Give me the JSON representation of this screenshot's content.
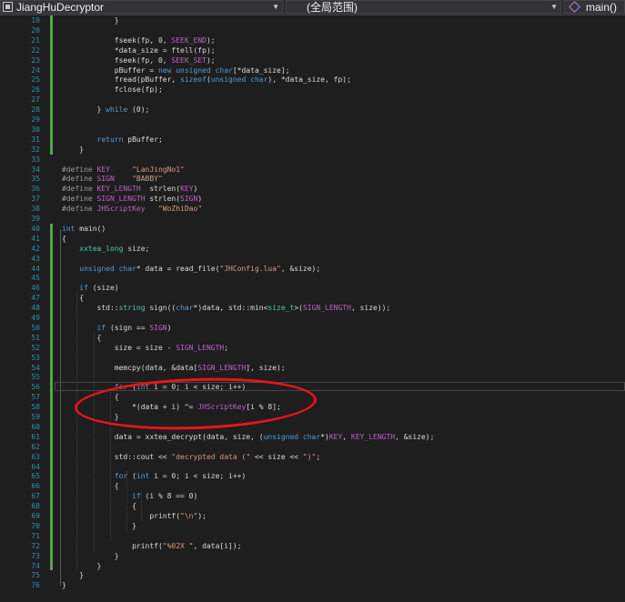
{
  "navbar": {
    "project": "JiangHuDecryptor",
    "scope": "(全局范围)",
    "function": "main()"
  },
  "colors": {
    "background": "#1e1e1e",
    "line_number": "#2b91af",
    "keyword": "#569cd6",
    "string": "#d69d85",
    "macro": "#bd63c5",
    "change_bar": "#57a64a",
    "annotation": "#e8141a"
  },
  "editor": {
    "lines": [
      {
        "n": "19",
        "segs": [
          [
            "            }",
            "p"
          ]
        ]
      },
      {
        "n": "20",
        "segs": []
      },
      {
        "n": "21",
        "segs": [
          [
            "            fseek(fp, 0, ",
            "p"
          ],
          [
            "SEEK_END",
            "mc"
          ],
          [
            ");",
            "p"
          ]
        ]
      },
      {
        "n": "22",
        "segs": [
          [
            "            *data_size = ftell(fp);",
            "p"
          ]
        ]
      },
      {
        "n": "23",
        "segs": [
          [
            "            fseek(fp, 0, ",
            "p"
          ],
          [
            "SEEK_SET",
            "mc"
          ],
          [
            ");",
            "p"
          ]
        ]
      },
      {
        "n": "24",
        "segs": [
          [
            "            pBuffer = ",
            "p"
          ],
          [
            "new unsigned char",
            "kw"
          ],
          [
            "[*data_size];",
            "p"
          ]
        ]
      },
      {
        "n": "25",
        "segs": [
          [
            "            fread(pBuffer, ",
            "p"
          ],
          [
            "sizeof",
            "kw"
          ],
          [
            "(",
            "p"
          ],
          [
            "unsigned char",
            "kw"
          ],
          [
            "), *data_size, fp);",
            "p"
          ]
        ]
      },
      {
        "n": "26",
        "segs": [
          [
            "            fclose(fp);",
            "p"
          ]
        ]
      },
      {
        "n": "27",
        "segs": []
      },
      {
        "n": "28",
        "segs": [
          [
            "        } ",
            "p"
          ],
          [
            "while",
            "kw"
          ],
          [
            " (0);",
            "p"
          ]
        ]
      },
      {
        "n": "29",
        "segs": []
      },
      {
        "n": "30",
        "segs": []
      },
      {
        "n": "31",
        "segs": [
          [
            "        ",
            "p"
          ],
          [
            "return",
            "kw"
          ],
          [
            " pBuffer;",
            "p"
          ]
        ]
      },
      {
        "n": "32",
        "segs": [
          [
            "    }",
            "p"
          ]
        ]
      },
      {
        "n": "33",
        "segs": []
      },
      {
        "n": "34",
        "segs": [
          [
            "#define ",
            "pp"
          ],
          [
            "KEY",
            "mc"
          ],
          [
            "     ",
            "p"
          ],
          [
            "\"LanJingNo1\"",
            "str"
          ]
        ]
      },
      {
        "n": "35",
        "segs": [
          [
            "#define ",
            "pp"
          ],
          [
            "SIGN",
            "mc"
          ],
          [
            "    ",
            "p"
          ],
          [
            "\"BABBY\"",
            "str"
          ]
        ]
      },
      {
        "n": "36",
        "segs": [
          [
            "#define ",
            "pp"
          ],
          [
            "KEY_LENGTH",
            "mc"
          ],
          [
            "  strlen(",
            "p"
          ],
          [
            "KEY",
            "mc"
          ],
          [
            ")",
            "p"
          ]
        ]
      },
      {
        "n": "37",
        "segs": [
          [
            "#define ",
            "pp"
          ],
          [
            "SIGN_LENGTH",
            "mc"
          ],
          [
            " strlen(",
            "p"
          ],
          [
            "SIGN",
            "mc"
          ],
          [
            ")",
            "p"
          ]
        ]
      },
      {
        "n": "38",
        "segs": [
          [
            "#define ",
            "pp"
          ],
          [
            "JHScriptKey",
            "mc"
          ],
          [
            "   ",
            "p"
          ],
          [
            "\"WoZhiDao\"",
            "str"
          ]
        ]
      },
      {
        "n": "39",
        "segs": []
      },
      {
        "n": "40",
        "segs": [
          [
            "int",
            "kw"
          ],
          [
            " main()",
            "p"
          ]
        ]
      },
      {
        "n": "41",
        "segs": [
          [
            "{",
            "p"
          ]
        ]
      },
      {
        "n": "42",
        "segs": [
          [
            "    ",
            "p"
          ],
          [
            "xxtea_long",
            "ty"
          ],
          [
            " size;",
            "p"
          ]
        ]
      },
      {
        "n": "43",
        "segs": []
      },
      {
        "n": "44",
        "segs": [
          [
            "    ",
            "p"
          ],
          [
            "unsigned char",
            "kw"
          ],
          [
            "* data = read_file(",
            "p"
          ],
          [
            "\"JHConfig.lua\"",
            "str"
          ],
          [
            ", &size);",
            "p"
          ]
        ]
      },
      {
        "n": "45",
        "segs": []
      },
      {
        "n": "46",
        "segs": [
          [
            "    ",
            "p"
          ],
          [
            "if",
            "kw"
          ],
          [
            " (size)",
            "p"
          ]
        ]
      },
      {
        "n": "47",
        "segs": [
          [
            "    {",
            "p"
          ]
        ]
      },
      {
        "n": "48",
        "segs": [
          [
            "        std::",
            "p"
          ],
          [
            "string",
            "ty"
          ],
          [
            " sign((",
            "p"
          ],
          [
            "char",
            "kw"
          ],
          [
            "*)data, std::min<",
            "p"
          ],
          [
            "size_t",
            "ty"
          ],
          [
            ">(",
            "p"
          ],
          [
            "SIGN_LENGTH",
            "mc"
          ],
          [
            ", size));",
            "p"
          ]
        ]
      },
      {
        "n": "49",
        "segs": []
      },
      {
        "n": "50",
        "segs": [
          [
            "        ",
            "p"
          ],
          [
            "if",
            "kw"
          ],
          [
            " (sign == ",
            "p"
          ],
          [
            "SIGN",
            "mc"
          ],
          [
            ")",
            "p"
          ]
        ]
      },
      {
        "n": "51",
        "segs": [
          [
            "        {",
            "p"
          ]
        ]
      },
      {
        "n": "52",
        "segs": [
          [
            "            size = size - ",
            "p"
          ],
          [
            "SIGN_LENGTH",
            "mc"
          ],
          [
            ";",
            "p"
          ]
        ]
      },
      {
        "n": "53",
        "segs": []
      },
      {
        "n": "54",
        "segs": [
          [
            "            memcpy(data, &data[",
            "p"
          ],
          [
            "SIGN_LENGTH",
            "mc"
          ],
          [
            "], size);",
            "p"
          ]
        ]
      },
      {
        "n": "55",
        "segs": []
      },
      {
        "n": "56",
        "segs": [
          [
            "            ",
            "p"
          ],
          [
            "for",
            "kw"
          ],
          [
            " (",
            "p"
          ],
          [
            "int",
            "kw"
          ],
          [
            " i = 0; i < size; i++)",
            "p"
          ]
        ]
      },
      {
        "n": "57",
        "segs": [
          [
            "            {",
            "p"
          ]
        ]
      },
      {
        "n": "58",
        "segs": [
          [
            "                *(data + i) ^= ",
            "p"
          ],
          [
            "JHScriptKey",
            "mc"
          ],
          [
            "[i % 8];",
            "p"
          ]
        ]
      },
      {
        "n": "59",
        "segs": [
          [
            "            }",
            "p"
          ]
        ]
      },
      {
        "n": "60",
        "segs": []
      },
      {
        "n": "61",
        "segs": [
          [
            "            data = xxtea_decrypt(data, size, (",
            "p"
          ],
          [
            "unsigned char",
            "kw"
          ],
          [
            "*)",
            "p"
          ],
          [
            "KEY",
            "mc"
          ],
          [
            ", ",
            "p"
          ],
          [
            "KEY_LENGTH",
            "mc"
          ],
          [
            ", &size);",
            "p"
          ]
        ]
      },
      {
        "n": "62",
        "segs": []
      },
      {
        "n": "63",
        "segs": [
          [
            "            std::cout << ",
            "p"
          ],
          [
            "\"decrypted data (\"",
            "str"
          ],
          [
            " << size << ",
            "p"
          ],
          [
            "\")\"",
            "str"
          ],
          [
            ";",
            "p"
          ]
        ]
      },
      {
        "n": "64",
        "segs": []
      },
      {
        "n": "65",
        "segs": [
          [
            "            ",
            "p"
          ],
          [
            "for",
            "kw"
          ],
          [
            " (",
            "p"
          ],
          [
            "int",
            "kw"
          ],
          [
            " i = 0; i < size; i++)",
            "p"
          ]
        ]
      },
      {
        "n": "66",
        "segs": [
          [
            "            {",
            "p"
          ]
        ]
      },
      {
        "n": "67",
        "segs": [
          [
            "                ",
            "p"
          ],
          [
            "if",
            "kw"
          ],
          [
            " (i % 8 == 0)",
            "p"
          ]
        ]
      },
      {
        "n": "68",
        "segs": [
          [
            "                {",
            "p"
          ]
        ]
      },
      {
        "n": "69",
        "segs": [
          [
            "                    printf(",
            "p"
          ],
          [
            "\"\\n\"",
            "str"
          ],
          [
            ");",
            "p"
          ]
        ]
      },
      {
        "n": "70",
        "segs": [
          [
            "                }",
            "p"
          ]
        ]
      },
      {
        "n": "71",
        "segs": []
      },
      {
        "n": "72",
        "segs": [
          [
            "                printf(",
            "p"
          ],
          [
            "\"%02X \"",
            "str"
          ],
          [
            ", data[i]);",
            "p"
          ]
        ]
      },
      {
        "n": "73",
        "segs": [
          [
            "            }",
            "p"
          ]
        ]
      },
      {
        "n": "74",
        "segs": [
          [
            "        }",
            "p"
          ]
        ]
      },
      {
        "n": "75",
        "segs": [
          [
            "    }",
            "p"
          ]
        ]
      },
      {
        "n": "76",
        "segs": [
          [
            "}",
            "p"
          ]
        ]
      }
    ]
  }
}
